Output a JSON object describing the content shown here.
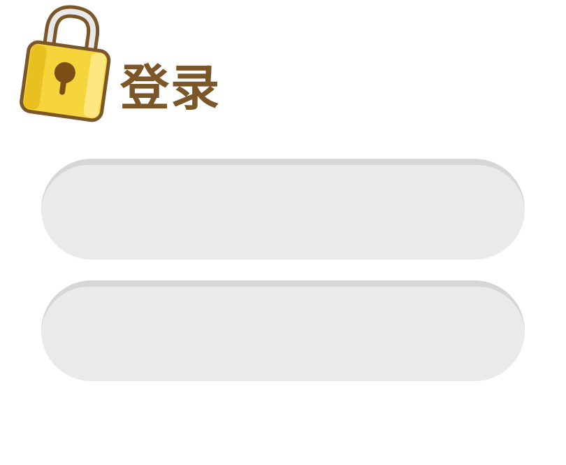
{
  "header": {
    "title": "登录",
    "icon": "lock-icon"
  },
  "form": {
    "username": {
      "value": "",
      "placeholder": ""
    },
    "password": {
      "value": "",
      "placeholder": ""
    }
  },
  "colors": {
    "title": "#7a5628",
    "field_bg": "#eaeaea",
    "field_shadow": "#d6d6d6",
    "lock_body": "#f6d43b",
    "lock_outline": "#7a5628"
  }
}
